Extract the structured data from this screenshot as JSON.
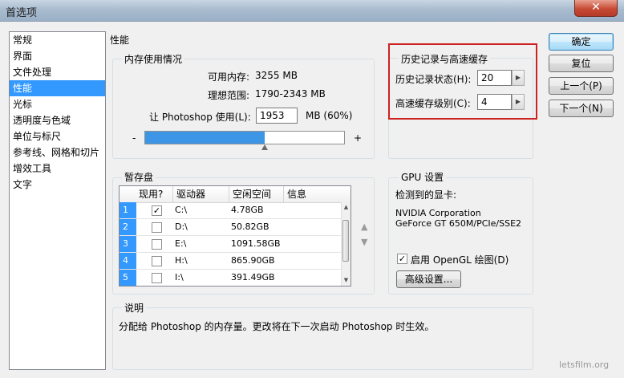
{
  "window": {
    "title": "首选项",
    "close": "✕"
  },
  "nav": {
    "items": [
      "常规",
      "界面",
      "文件处理",
      "性能",
      "光标",
      "透明度与色域",
      "单位与标尺",
      "参考线、网格和切片",
      "增效工具",
      "文字"
    ],
    "selected_index": 3
  },
  "section_title": "性能",
  "memory": {
    "group_label": "内存使用情况",
    "available_label": "可用内存:",
    "available_value": "3255 MB",
    "ideal_label": "理想范围:",
    "ideal_value": "1790-2343 MB",
    "let_label": "让 Photoshop 使用(L):",
    "use_value": "1953",
    "use_unit": "MB (60%)",
    "minus": "-",
    "plus": "+",
    "slider_fraction": 0.6
  },
  "history": {
    "group_label": "历史记录与高速缓存",
    "states_label": "历史记录状态(H):",
    "states_value": "20",
    "cache_label": "高速缓存级别(C):",
    "cache_value": "4"
  },
  "scratch": {
    "group_label": "暂存盘",
    "columns": [
      "现用?",
      "驱动器",
      "空闲空间",
      "信息"
    ],
    "rows": [
      {
        "num": "1",
        "active": true,
        "drive": "C:\\",
        "free": "4.78GB"
      },
      {
        "num": "2",
        "active": false,
        "drive": "D:\\",
        "free": "50.82GB"
      },
      {
        "num": "3",
        "active": false,
        "drive": "E:\\",
        "free": "1091.58GB"
      },
      {
        "num": "4",
        "active": false,
        "drive": "H:\\",
        "free": "865.90GB"
      },
      {
        "num": "5",
        "active": false,
        "drive": "I:\\",
        "free": "391.49GB"
      }
    ],
    "move_up": "▲",
    "move_down": "▼"
  },
  "gpu": {
    "group_label": "GPU 设置",
    "detected_label": "检测到的显卡:",
    "card_line1": "NVIDIA Corporation",
    "card_line2": "GeForce GT 650M/PCIe/SSE2",
    "opengl_label": "启用 OpenGL 绘图(D)",
    "opengl_checked": true,
    "advanced_button": "高级设置..."
  },
  "description": {
    "group_label": "说明",
    "text": "分配给 Photoshop 的内存量。更改将在下一次启动 Photoshop 时生效。"
  },
  "buttons": {
    "ok": "确定",
    "reset": "复位",
    "prev": "上一个(P)",
    "next": "下一个(N)"
  },
  "watermark": "letsfilm.org",
  "colors": {
    "selection": "#3399ff",
    "slider_fill": "#3d95e6",
    "highlight_frame": "#cc2222"
  }
}
